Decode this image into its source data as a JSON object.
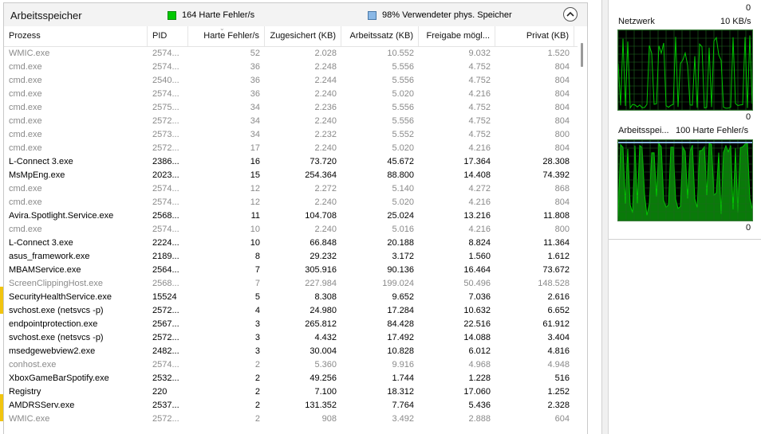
{
  "section": {
    "title": "Arbeitsspeicher",
    "legend_hard_faults": "164 Harte Fehler/s",
    "legend_hard_faults_color": "#00c800",
    "legend_used_memory": "98% Verwendeter phys. Speicher",
    "legend_used_memory_color": "#8ab8e6",
    "collapse_icon": "chevron-up-icon"
  },
  "columns": [
    "Prozess",
    "PID",
    "Harte Fehler/s",
    "Zugesichert (KB)",
    "Arbeitssatz (KB)",
    "Freigabe mögl...",
    "Privat (KB)"
  ],
  "rows": [
    {
      "name": "WMIC.exe",
      "pid": "2574...",
      "faults": "52",
      "committed": "2.028",
      "working": "10.552",
      "shareable": "9.032",
      "private": "1.520",
      "dim": true
    },
    {
      "name": "cmd.exe",
      "pid": "2574...",
      "faults": "36",
      "committed": "2.248",
      "working": "5.556",
      "shareable": "4.752",
      "private": "804",
      "dim": true
    },
    {
      "name": "cmd.exe",
      "pid": "2540...",
      "faults": "36",
      "committed": "2.244",
      "working": "5.556",
      "shareable": "4.752",
      "private": "804",
      "dim": true
    },
    {
      "name": "cmd.exe",
      "pid": "2574...",
      "faults": "36",
      "committed": "2.240",
      "working": "5.020",
      "shareable": "4.216",
      "private": "804",
      "dim": true
    },
    {
      "name": "cmd.exe",
      "pid": "2575...",
      "faults": "34",
      "committed": "2.236",
      "working": "5.556",
      "shareable": "4.752",
      "private": "804",
      "dim": true
    },
    {
      "name": "cmd.exe",
      "pid": "2572...",
      "faults": "34",
      "committed": "2.240",
      "working": "5.556",
      "shareable": "4.752",
      "private": "804",
      "dim": true
    },
    {
      "name": "cmd.exe",
      "pid": "2573...",
      "faults": "34",
      "committed": "2.232",
      "working": "5.552",
      "shareable": "4.752",
      "private": "800",
      "dim": true
    },
    {
      "name": "cmd.exe",
      "pid": "2572...",
      "faults": "17",
      "committed": "2.240",
      "working": "5.020",
      "shareable": "4.216",
      "private": "804",
      "dim": true
    },
    {
      "name": "L-Connect 3.exe",
      "pid": "2386...",
      "faults": "16",
      "committed": "73.720",
      "working": "45.672",
      "shareable": "17.364",
      "private": "28.308",
      "dim": false
    },
    {
      "name": "MsMpEng.exe",
      "pid": "2023...",
      "faults": "15",
      "committed": "254.364",
      "working": "88.800",
      "shareable": "14.408",
      "private": "74.392",
      "dim": false
    },
    {
      "name": "cmd.exe",
      "pid": "2574...",
      "faults": "12",
      "committed": "2.272",
      "working": "5.140",
      "shareable": "4.272",
      "private": "868",
      "dim": true
    },
    {
      "name": "cmd.exe",
      "pid": "2574...",
      "faults": "12",
      "committed": "2.240",
      "working": "5.020",
      "shareable": "4.216",
      "private": "804",
      "dim": true
    },
    {
      "name": "Avira.Spotlight.Service.exe",
      "pid": "2568...",
      "faults": "11",
      "committed": "104.708",
      "working": "25.024",
      "shareable": "13.216",
      "private": "11.808",
      "dim": false
    },
    {
      "name": "cmd.exe",
      "pid": "2574...",
      "faults": "10",
      "committed": "2.240",
      "working": "5.016",
      "shareable": "4.216",
      "private": "800",
      "dim": true
    },
    {
      "name": "L-Connect 3.exe",
      "pid": "2224...",
      "faults": "10",
      "committed": "66.848",
      "working": "20.188",
      "shareable": "8.824",
      "private": "11.364",
      "dim": false
    },
    {
      "name": "asus_framework.exe",
      "pid": "2189...",
      "faults": "8",
      "committed": "29.232",
      "working": "3.172",
      "shareable": "1.560",
      "private": "1.612",
      "dim": false
    },
    {
      "name": "MBAMService.exe",
      "pid": "2564...",
      "faults": "7",
      "committed": "305.916",
      "working": "90.136",
      "shareable": "16.464",
      "private": "73.672",
      "dim": false
    },
    {
      "name": "ScreenClippingHost.exe",
      "pid": "2568...",
      "faults": "7",
      "committed": "227.984",
      "working": "199.024",
      "shareable": "50.496",
      "private": "148.528",
      "dim": true
    },
    {
      "name": "SecurityHealthService.exe",
      "pid": "15524",
      "faults": "5",
      "committed": "8.308",
      "working": "9.652",
      "shareable": "7.036",
      "private": "2.616",
      "dim": false
    },
    {
      "name": "svchost.exe (netsvcs -p)",
      "pid": "2572...",
      "faults": "4",
      "committed": "24.980",
      "working": "17.284",
      "shareable": "10.632",
      "private": "6.652",
      "dim": false
    },
    {
      "name": "endpointprotection.exe",
      "pid": "2567...",
      "faults": "3",
      "committed": "265.812",
      "working": "84.428",
      "shareable": "22.516",
      "private": "61.912",
      "dim": false
    },
    {
      "name": "svchost.exe (netsvcs -p)",
      "pid": "2572...",
      "faults": "3",
      "committed": "4.432",
      "working": "17.492",
      "shareable": "14.088",
      "private": "3.404",
      "dim": false
    },
    {
      "name": "msedgewebview2.exe",
      "pid": "2482...",
      "faults": "3",
      "committed": "30.004",
      "working": "10.828",
      "shareable": "6.012",
      "private": "4.816",
      "dim": false
    },
    {
      "name": "conhost.exe",
      "pid": "2574...",
      "faults": "2",
      "committed": "5.360",
      "working": "9.916",
      "shareable": "4.968",
      "private": "4.948",
      "dim": true
    },
    {
      "name": "XboxGameBarSpotify.exe",
      "pid": "2532...",
      "faults": "2",
      "committed": "49.256",
      "working": "1.744",
      "shareable": "1.228",
      "private": "516",
      "dim": false
    },
    {
      "name": "Registry",
      "pid": "220",
      "faults": "2",
      "committed": "7.100",
      "working": "18.312",
      "shareable": "17.060",
      "private": "1.252",
      "dim": false
    },
    {
      "name": "AMDRSServ.exe",
      "pid": "2537...",
      "faults": "2",
      "committed": "131.352",
      "working": "7.764",
      "shareable": "5.436",
      "private": "2.328",
      "dim": false
    },
    {
      "name": "WMIC.exe",
      "pid": "2572...",
      "faults": "2",
      "committed": "908",
      "working": "3.492",
      "shareable": "2.888",
      "private": "604",
      "dim": true
    }
  ],
  "side_panel": {
    "top_zero": "0",
    "network_label": "Netzwerk",
    "network_value": "10 KB/s",
    "network_zero": "0",
    "memory_label": "Arbeitsspei...",
    "memory_value": "100 Harte Fehler/s",
    "memory_zero": "0",
    "graph_color": "#00c800"
  }
}
